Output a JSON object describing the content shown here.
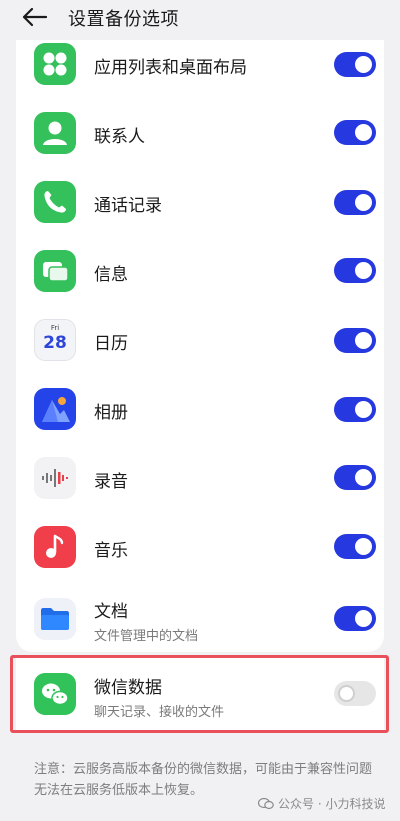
{
  "header": {
    "title": "设置备份选项"
  },
  "items": [
    {
      "label": "应用列表和桌面布局",
      "icon": "app-grid-icon",
      "enabled": true
    },
    {
      "label": "联系人",
      "icon": "contacts-icon",
      "enabled": true
    },
    {
      "label": "通话记录",
      "icon": "phone-icon",
      "enabled": true
    },
    {
      "label": "信息",
      "icon": "messages-icon",
      "enabled": true
    },
    {
      "label": "日历",
      "icon": "calendar-icon",
      "enabled": true,
      "icon_text": {
        "day": "Fri",
        "date": "28"
      }
    },
    {
      "label": "相册",
      "icon": "gallery-icon",
      "enabled": true
    },
    {
      "label": "录音",
      "icon": "recorder-icon",
      "enabled": true
    },
    {
      "label": "音乐",
      "icon": "music-icon",
      "enabled": true
    },
    {
      "label": "文档",
      "sub": "文件管理中的文档",
      "icon": "folder-icon",
      "enabled": true
    }
  ],
  "wechat": {
    "label": "微信数据",
    "sub": "聊天记录、接收的文件",
    "icon": "wechat-icon",
    "enabled": false
  },
  "note": "注意：云服务高版本备份的微信数据，可能由于兼容性问题无法在云服务低版本上恢复。",
  "watermark": "公众号 · 小力科技说",
  "colors": {
    "accent": "#2638e0",
    "highlight": "#e9505a"
  }
}
